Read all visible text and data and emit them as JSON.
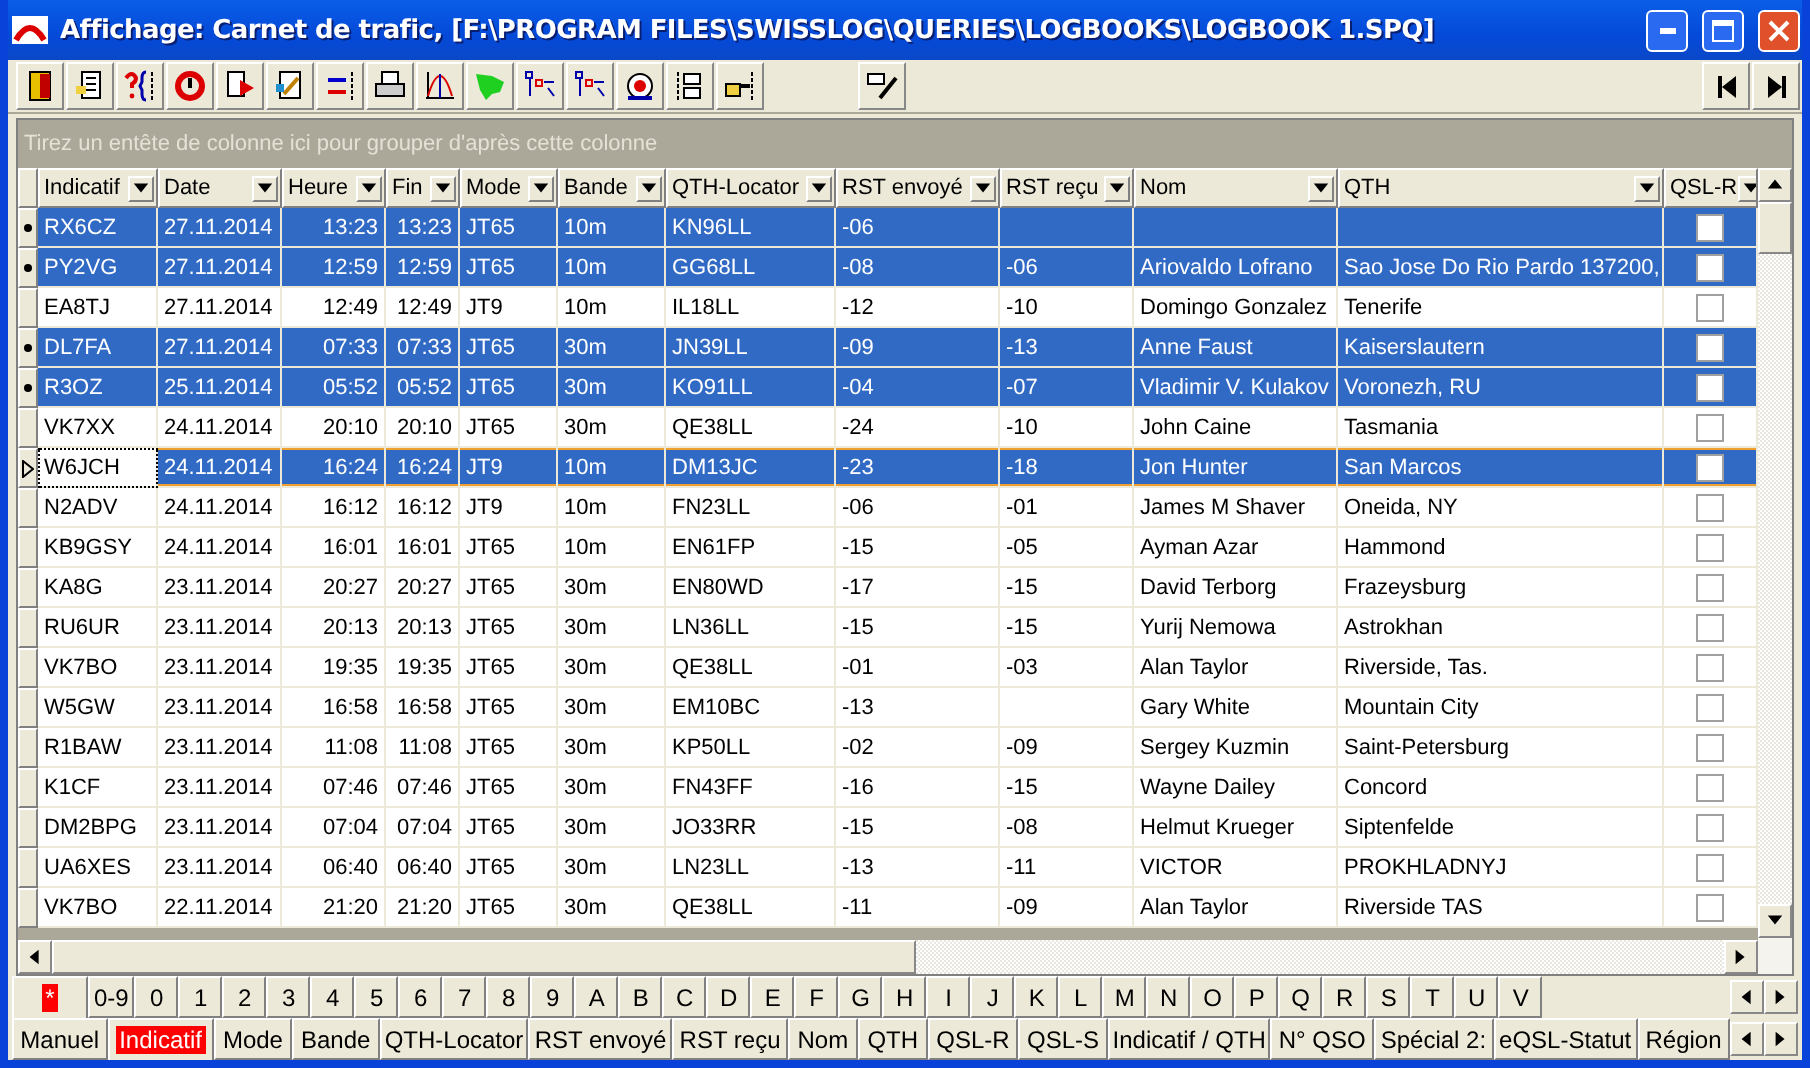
{
  "window": {
    "title": "Affichage: Carnet de trafic, [F:\\PROGRAM FILES\\SWISSLOG\\QUERIES\\LOGBOOKS\\LOGBOOK  1.SPQ]"
  },
  "group_hint": "Tirez un entête de colonne ici pour grouper d'après cette colonne",
  "columns": [
    "Indicatif",
    "Date",
    "Heure",
    "Fin",
    "Mode",
    "Bande",
    "QTH-Locator",
    "RST envoyé",
    "RST reçu",
    "Nom",
    "QTH",
    "QSL-R"
  ],
  "rows": [
    {
      "selected": true,
      "current": false,
      "cells": [
        "RX6CZ",
        "27.11.2014",
        "13:23",
        "13:23",
        "JT65",
        "10m",
        "KN96LL",
        "-06",
        "",
        "",
        ""
      ],
      "qsl_r": false
    },
    {
      "selected": true,
      "current": false,
      "cells": [
        "PY2VG",
        "27.11.2014",
        "12:59",
        "12:59",
        "JT65",
        "10m",
        "GG68LL",
        "-08",
        "-06",
        "Ariovaldo Lofrano",
        "Sao Jose Do Rio Pardo 137200,"
      ],
      "qsl_r": false
    },
    {
      "selected": false,
      "current": false,
      "cells": [
        "EA8TJ",
        "27.11.2014",
        "12:49",
        "12:49",
        "JT9",
        "10m",
        "IL18LL",
        "-12",
        "-10",
        "Domingo Gonzalez",
        "Tenerife"
      ],
      "qsl_r": false
    },
    {
      "selected": true,
      "current": false,
      "cells": [
        "DL7FA",
        "27.11.2014",
        "07:33",
        "07:33",
        "JT65",
        "30m",
        "JN39LL",
        "-09",
        "-13",
        "Anne Faust",
        "Kaiserslautern"
      ],
      "qsl_r": false
    },
    {
      "selected": true,
      "current": false,
      "cells": [
        "R3OZ",
        "25.11.2014",
        "05:52",
        "05:52",
        "JT65",
        "30m",
        "KO91LL",
        "-04",
        "-07",
        "Vladimir V. Kulakov",
        "Voronezh, RU"
      ],
      "qsl_r": false
    },
    {
      "selected": false,
      "current": false,
      "cells": [
        "VK7XX",
        "24.11.2014",
        "20:10",
        "20:10",
        "JT65",
        "30m",
        "QE38LL",
        "-24",
        "-10",
        "John Caine",
        "Tasmania"
      ],
      "qsl_r": false
    },
    {
      "selected": true,
      "current": true,
      "cells": [
        "W6JCH",
        "24.11.2014",
        "16:24",
        "16:24",
        "JT9",
        "10m",
        "DM13JC",
        "-23",
        "-18",
        "Jon Hunter",
        "San Marcos"
      ],
      "qsl_r": false
    },
    {
      "selected": false,
      "current": false,
      "cells": [
        "N2ADV",
        "24.11.2014",
        "16:12",
        "16:12",
        "JT9",
        "10m",
        "FN23LL",
        "-06",
        "-01",
        "James M Shaver",
        "Oneida, NY"
      ],
      "qsl_r": false
    },
    {
      "selected": false,
      "current": false,
      "cells": [
        "KB9GSY",
        "24.11.2014",
        "16:01",
        "16:01",
        "JT65",
        "10m",
        "EN61FP",
        "-15",
        "-05",
        "Ayman Azar",
        "Hammond"
      ],
      "qsl_r": false
    },
    {
      "selected": false,
      "current": false,
      "cells": [
        "KA8G",
        "23.11.2014",
        "20:27",
        "20:27",
        "JT65",
        "30m",
        "EN80WD",
        "-17",
        "-15",
        "David Terborg",
        "Frazeysburg"
      ],
      "qsl_r": false
    },
    {
      "selected": false,
      "current": false,
      "cells": [
        "RU6UR",
        "23.11.2014",
        "20:13",
        "20:13",
        "JT65",
        "30m",
        "LN36LL",
        "-15",
        "-15",
        "Yurij Nemowa",
        "Astrokhan"
      ],
      "qsl_r": false
    },
    {
      "selected": false,
      "current": false,
      "cells": [
        "VK7BO",
        "23.11.2014",
        "19:35",
        "19:35",
        "JT65",
        "30m",
        "QE38LL",
        "-01",
        "-03",
        "Alan Taylor",
        "Riverside, Tas."
      ],
      "qsl_r": false
    },
    {
      "selected": false,
      "current": false,
      "cells": [
        "W5GW",
        "23.11.2014",
        "16:58",
        "16:58",
        "JT65",
        "30m",
        "EM10BC",
        "-13",
        "",
        "Gary White",
        "Mountain City"
      ],
      "qsl_r": false
    },
    {
      "selected": false,
      "current": false,
      "cells": [
        "R1BAW",
        "23.11.2014",
        "11:08",
        "11:08",
        "JT65",
        "30m",
        "KP50LL",
        "-02",
        "-09",
        "Sergey Kuzmin",
        "Saint-Petersburg"
      ],
      "qsl_r": false
    },
    {
      "selected": false,
      "current": false,
      "cells": [
        "K1CF",
        "23.11.2014",
        "07:46",
        "07:46",
        "JT65",
        "30m",
        "FN43FF",
        "-16",
        "-15",
        "Wayne Dailey",
        "Concord"
      ],
      "qsl_r": false
    },
    {
      "selected": false,
      "current": false,
      "cells": [
        "DM2BPG",
        "23.11.2014",
        "07:04",
        "07:04",
        "JT65",
        "30m",
        "JO33RR",
        "-15",
        "-08",
        "Helmut Krueger",
        "Siptenfelde"
      ],
      "qsl_r": false
    },
    {
      "selected": false,
      "current": false,
      "cells": [
        "UA6XES",
        "23.11.2014",
        "06:40",
        "06:40",
        "JT65",
        "30m",
        "LN23LL",
        "-13",
        "-11",
        "VICTOR",
        "PROKHLADNYJ"
      ],
      "qsl_r": false
    },
    {
      "selected": false,
      "current": false,
      "cells": [
        "VK7BO",
        "22.11.2014",
        "21:20",
        "21:20",
        "JT65",
        "30m",
        "QE38LL",
        "-11",
        "-09",
        "Alan Taylor",
        "Riverside TAS"
      ],
      "qsl_r": false
    }
  ],
  "letter_tabs": [
    {
      "label": "*",
      "selected": true
    },
    {
      "label": "0-9",
      "selected": false
    },
    {
      "label": "0",
      "selected": false
    },
    {
      "label": "1",
      "selected": false
    },
    {
      "label": "2",
      "selected": false
    },
    {
      "label": "3",
      "selected": false
    },
    {
      "label": "4",
      "selected": false
    },
    {
      "label": "5",
      "selected": false
    },
    {
      "label": "6",
      "selected": false
    },
    {
      "label": "7",
      "selected": false
    },
    {
      "label": "8",
      "selected": false
    },
    {
      "label": "9",
      "selected": false
    },
    {
      "label": "A",
      "selected": false
    },
    {
      "label": "B",
      "selected": false
    },
    {
      "label": "C",
      "selected": false
    },
    {
      "label": "D",
      "selected": false
    },
    {
      "label": "E",
      "selected": false
    },
    {
      "label": "F",
      "selected": false
    },
    {
      "label": "G",
      "selected": false
    },
    {
      "label": "H",
      "selected": false
    },
    {
      "label": "I",
      "selected": false
    },
    {
      "label": "J",
      "selected": false
    },
    {
      "label": "K",
      "selected": false
    },
    {
      "label": "L",
      "selected": false
    },
    {
      "label": "M",
      "selected": false
    },
    {
      "label": "N",
      "selected": false
    },
    {
      "label": "O",
      "selected": false
    },
    {
      "label": "P",
      "selected": false
    },
    {
      "label": "Q",
      "selected": false
    },
    {
      "label": "R",
      "selected": false
    },
    {
      "label": "S",
      "selected": false
    },
    {
      "label": "T",
      "selected": false
    },
    {
      "label": "U",
      "selected": false
    },
    {
      "label": "V",
      "selected": false
    }
  ],
  "sort_tabs": [
    {
      "label": "Manuel",
      "selected": false
    },
    {
      "label": "Indicatif",
      "selected": true
    },
    {
      "label": "Mode",
      "selected": false
    },
    {
      "label": "Bande",
      "selected": false
    },
    {
      "label": "QTH-Locator",
      "selected": false
    },
    {
      "label": "RST envoyé",
      "selected": false
    },
    {
      "label": "RST reçu",
      "selected": false
    },
    {
      "label": "Nom",
      "selected": false
    },
    {
      "label": "QTH",
      "selected": false
    },
    {
      "label": "QSL-R",
      "selected": false
    },
    {
      "label": "QSL-S",
      "selected": false
    },
    {
      "label": "Indicatif / QTH",
      "selected": false
    },
    {
      "label": "N° QSO",
      "selected": false
    },
    {
      "label": "Spécial 2:",
      "selected": false
    },
    {
      "label": "eQSL-Statut",
      "selected": false
    },
    {
      "label": "Région",
      "selected": false
    }
  ]
}
